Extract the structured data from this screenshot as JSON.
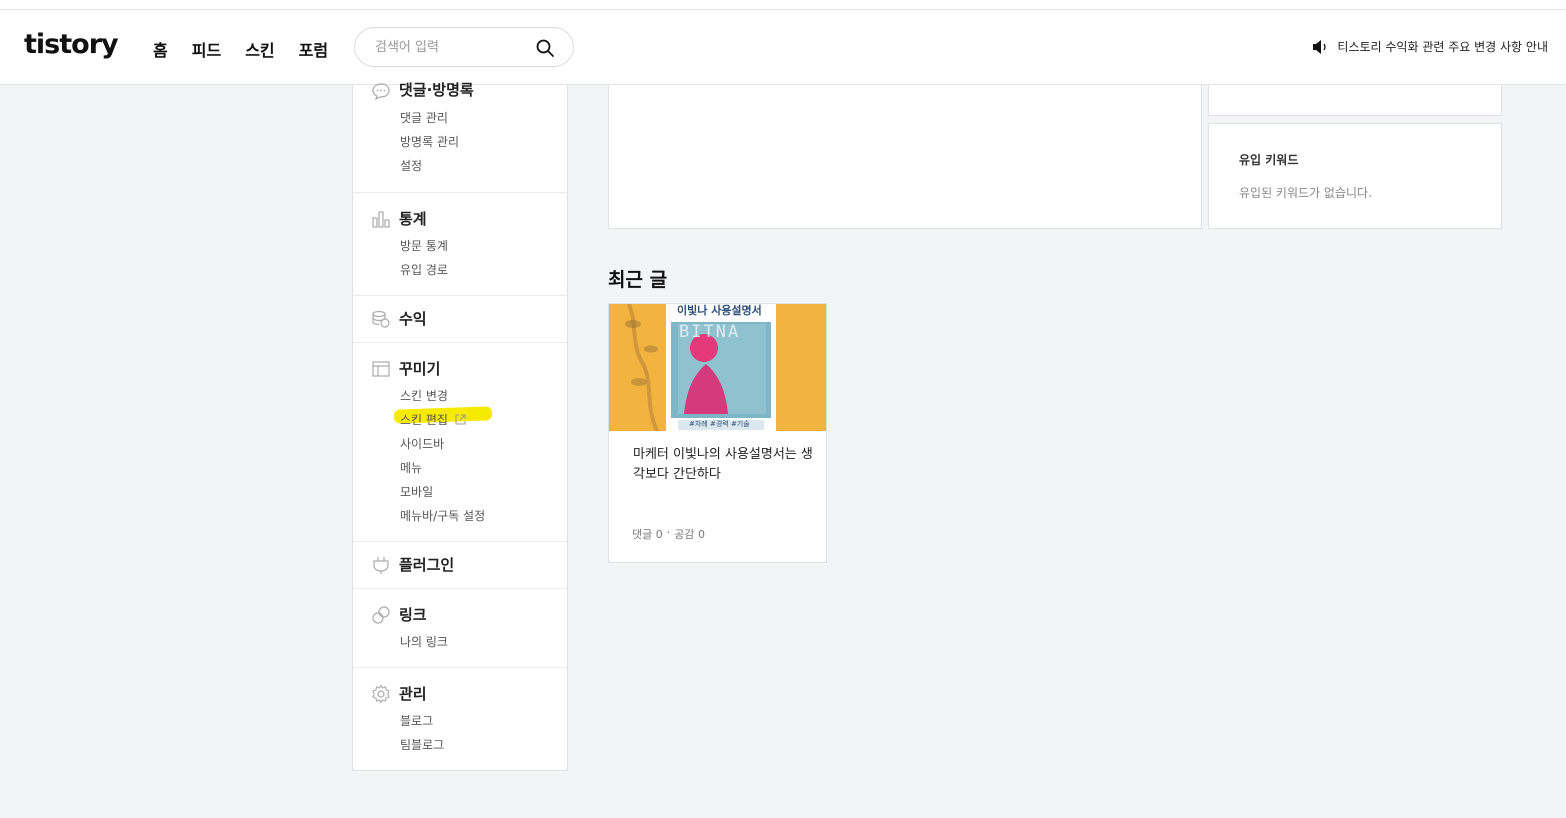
{
  "header": {
    "logo": "tistory",
    "nav": [
      "홈",
      "피드",
      "스킨",
      "포럼"
    ],
    "search_placeholder": "검색어 입력",
    "notice": "티스토리 수익화 관련 주요 변경 사항 안내"
  },
  "sidebar": {
    "comments": {
      "title": "댓글·방명록",
      "items": [
        "댓글 관리",
        "방명록 관리",
        "설정"
      ]
    },
    "stats": {
      "title": "통계",
      "items": [
        "방문 통계",
        "유입 경로"
      ]
    },
    "revenue": {
      "title": "수익"
    },
    "decorate": {
      "title": "꾸미기",
      "items": [
        "스킨 변경",
        "스킨 편집",
        "사이드바",
        "메뉴",
        "모바일",
        "메뉴바/구독 설정"
      ]
    },
    "plugin": {
      "title": "플러그인"
    },
    "link": {
      "title": "링크",
      "items": [
        "나의 링크"
      ]
    },
    "manage": {
      "title": "관리",
      "items": [
        "블로그",
        "팀블로그"
      ]
    }
  },
  "keywords": {
    "title": "유입 키워드",
    "empty": "유입된 키워드가 없습니다."
  },
  "recent": {
    "title": "최근 글",
    "posts": [
      {
        "title": "마케터 이빛나의 사용설명서는 생각보다 간단하다",
        "thumb_heading": "이빛나 사용설명서",
        "thumb_text": "BITNA",
        "thumb_tags": "#차례 #경력 #기술",
        "comments": "댓글 0",
        "likes": "공감 0"
      }
    ]
  },
  "colors": {
    "highlight": "#f6ea00",
    "thumb_bg": "#f2b43f",
    "thumb_card": "#7eb6c7",
    "accent_pink": "#e23a7a"
  }
}
